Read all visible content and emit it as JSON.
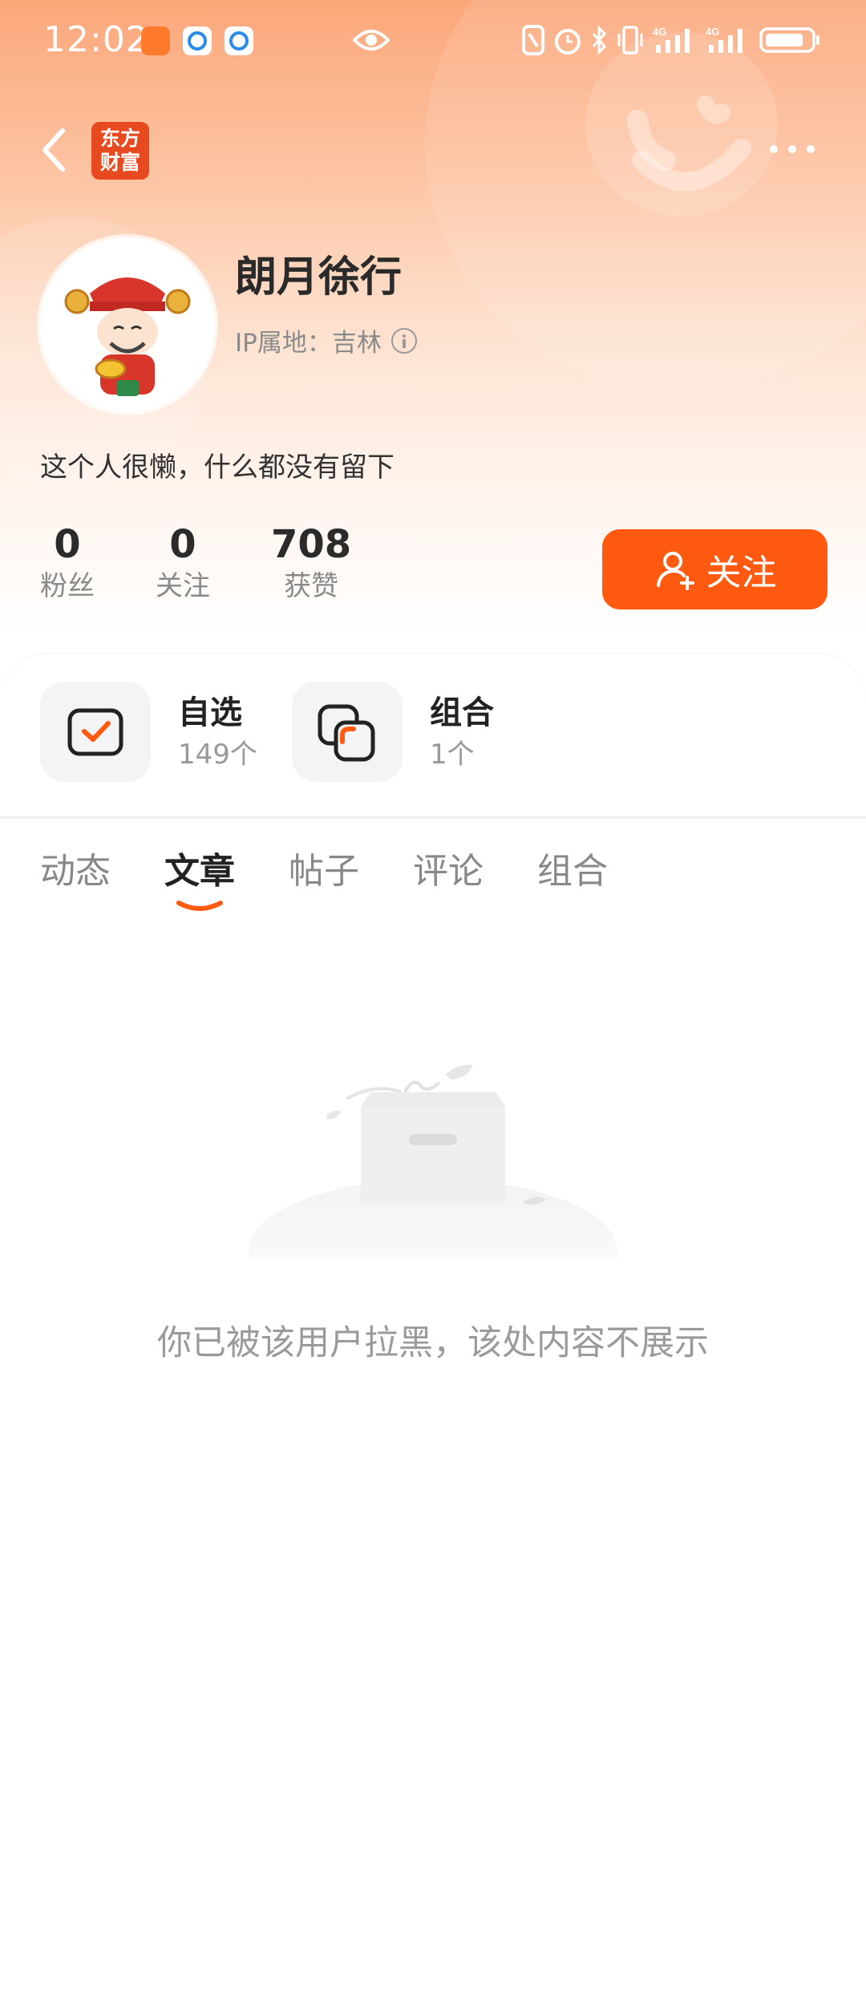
{
  "status_bar": {
    "time": "12:02"
  },
  "header": {
    "logo_text_1": "东方",
    "logo_text_2": "财富"
  },
  "profile": {
    "name": "朗月徐行",
    "ip_label": "IP属地：吉林",
    "bio": "这个人很懒，什么都没有留下"
  },
  "stats": [
    {
      "value": "0",
      "label": "粉丝"
    },
    {
      "value": "0",
      "label": "关注"
    },
    {
      "value": "708",
      "label": "获赞"
    }
  ],
  "follow_button": {
    "label": "关注"
  },
  "tiles": [
    {
      "title": "自选",
      "count": "149个"
    },
    {
      "title": "组合",
      "count": "1个"
    }
  ],
  "tabs": [
    "动态",
    "文章",
    "帖子",
    "评论",
    "组合"
  ],
  "active_tab_index": 1,
  "empty_state": {
    "message": "你已被该用户拉黑，该处内容不展示"
  },
  "colors": {
    "accent": "#ff5a10",
    "logo": "#e84a1f"
  }
}
